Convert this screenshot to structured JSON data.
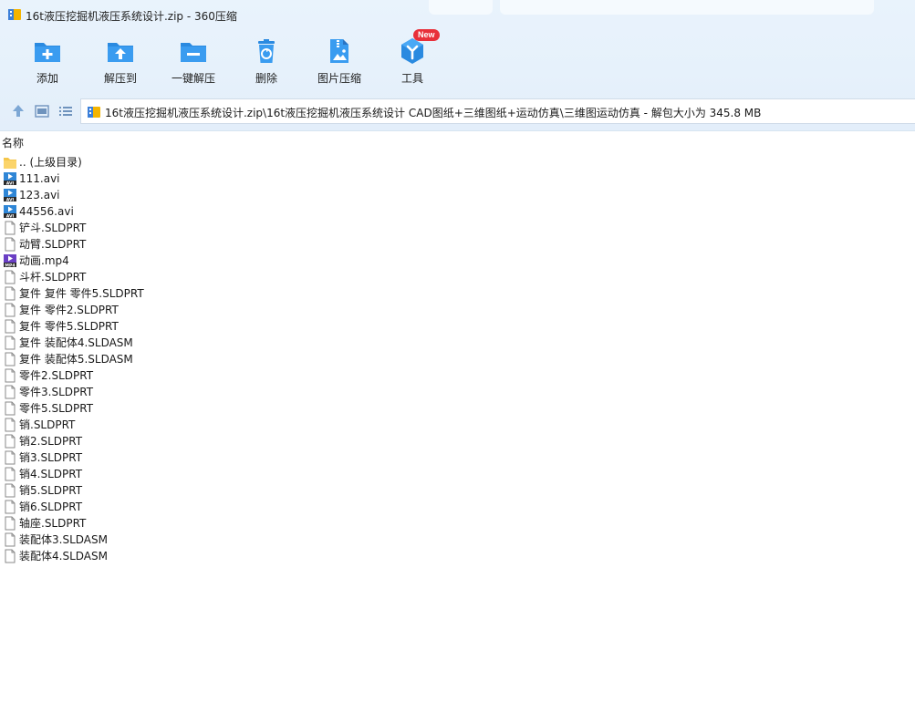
{
  "window": {
    "title": "16t液压挖掘机液压系统设计.zip - 360压缩"
  },
  "toolbar": {
    "items": [
      {
        "label": "添加",
        "icon": "add-folder-icon"
      },
      {
        "label": "解压到",
        "icon": "extract-to-icon"
      },
      {
        "label": "一键解压",
        "icon": "one-click-extract-icon"
      },
      {
        "label": "删除",
        "icon": "delete-bin-icon"
      },
      {
        "label": "图片压缩",
        "icon": "image-compress-icon"
      },
      {
        "label": "工具",
        "icon": "tools-icon"
      }
    ],
    "new_badge": "New"
  },
  "nav": {
    "path": "16t液压挖掘机液压系统设计.zip\\16t液压挖掘机液压系统设计 CAD图纸+三维图纸+运动仿真\\三维图运动仿真 - 解包大小为 345.8 MB"
  },
  "list": {
    "column_name": "名称",
    "files": [
      {
        "name": ".. (上级目录)",
        "type": "folder"
      },
      {
        "name": "111.avi",
        "type": "avi"
      },
      {
        "name": "123.avi",
        "type": "avi"
      },
      {
        "name": "44556.avi",
        "type": "avi"
      },
      {
        "name": "铲斗.SLDPRT",
        "type": "file"
      },
      {
        "name": "动臂.SLDPRT",
        "type": "file"
      },
      {
        "name": "动画.mp4",
        "type": "mp4"
      },
      {
        "name": "斗杆.SLDPRT",
        "type": "file"
      },
      {
        "name": "复件 复件 零件5.SLDPRT",
        "type": "file"
      },
      {
        "name": "复件 零件2.SLDPRT",
        "type": "file"
      },
      {
        "name": "复件 零件5.SLDPRT",
        "type": "file"
      },
      {
        "name": "复件 装配体4.SLDASM",
        "type": "file"
      },
      {
        "name": "复件 装配体5.SLDASM",
        "type": "file"
      },
      {
        "name": "零件2.SLDPRT",
        "type": "file"
      },
      {
        "name": "零件3.SLDPRT",
        "type": "file"
      },
      {
        "name": "零件5.SLDPRT",
        "type": "file"
      },
      {
        "name": "销.SLDPRT",
        "type": "file"
      },
      {
        "name": "销2.SLDPRT",
        "type": "file"
      },
      {
        "name": "销3.SLDPRT",
        "type": "file"
      },
      {
        "name": "销4.SLDPRT",
        "type": "file"
      },
      {
        "name": "销5.SLDPRT",
        "type": "file"
      },
      {
        "name": "销6.SLDPRT",
        "type": "file"
      },
      {
        "name": "轴座.SLDPRT",
        "type": "file"
      },
      {
        "name": "装配体3.SLDASM",
        "type": "file"
      },
      {
        "name": "装配体4.SLDASM",
        "type": "file"
      }
    ]
  },
  "colors": {
    "accent": "#2a8ae0",
    "header_bg": "#e6f1fb",
    "badge": "#e8303a"
  }
}
